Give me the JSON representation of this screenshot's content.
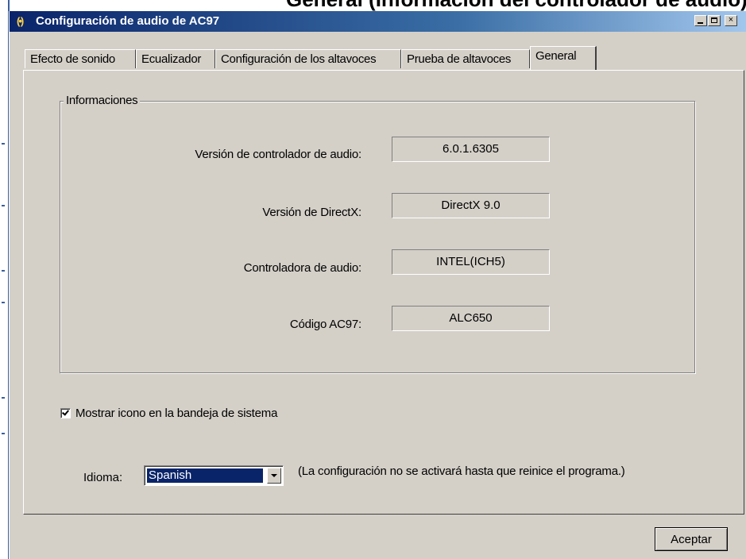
{
  "background_heading_fragment": "General (Información del controlador de audio)",
  "window": {
    "title": "Configuración de audio de AC97",
    "icon": "speaker-waves-icon",
    "icon_glyph": "(•)",
    "minimize_glyph": "_",
    "close_glyph": "×"
  },
  "tabs": [
    {
      "label": "Efecto de sonido",
      "active": false
    },
    {
      "label": "Ecualizador",
      "active": false
    },
    {
      "label": "Configuración de los altavoces",
      "active": false
    },
    {
      "label": "Prueba de altavoces",
      "active": false
    },
    {
      "label": "General",
      "active": true
    }
  ],
  "info": {
    "group_title": "Informaciones",
    "rows": [
      {
        "label": "Versión de controlador de audio:",
        "value": "6.0.1.6305"
      },
      {
        "label": "Versión de DirectX:",
        "value": "DirectX 9.0"
      },
      {
        "label": "Controladora de audio:",
        "value": "INTEL(ICH5)"
      },
      {
        "label": "Código AC97:",
        "value": "ALC650"
      }
    ]
  },
  "tray_checkbox": {
    "label": "Mostrar icono en la bandeja de sistema",
    "checked": true
  },
  "language": {
    "label": "Idioma:",
    "selected": "Spanish",
    "note": "(La configuración no se activará hasta que reinice el programa.)"
  },
  "ok_button": "Aceptar",
  "colors": {
    "face": "#d4d0c8",
    "titlebar_start": "#0a246a",
    "titlebar_end": "#a6caf0",
    "selection": "#0a246a"
  }
}
